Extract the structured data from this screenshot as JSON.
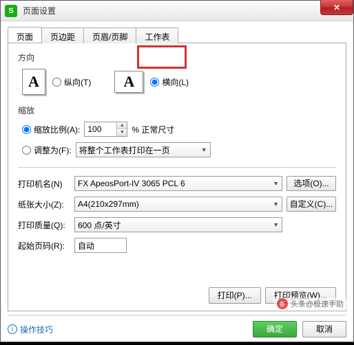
{
  "window": {
    "title": "页面设置"
  },
  "tabs": {
    "t0": "页面",
    "t1": "页边距",
    "t2": "页眉/页脚",
    "t3": "工作表"
  },
  "orient": {
    "label": "方向",
    "portrait": "纵向(T)",
    "landscape": "横向(L)",
    "iconA": "A"
  },
  "scale": {
    "label": "缩放",
    "ratio": "缩放比例(A):",
    "ratioVal": "100",
    "ratioSuffix": "% 正常尺寸",
    "fit": "调整为(F):",
    "fitVal": "将整个工作表打印在一页"
  },
  "printer": {
    "nameLbl": "打印机名(N)",
    "nameVal": "FX ApeosPort-IV 3065 PCL 6",
    "options": "选项(O)...",
    "sizeLbl": "纸张大小(Z):",
    "sizeVal": "A4(210x297mm)",
    "custom": "自定义(C)...",
    "qualLbl": "打印质量(Q):",
    "qualVal": "600 点/英寸",
    "startLbl": "起始页码(R):",
    "startVal": "自动"
  },
  "actions": {
    "print": "打印(P)...",
    "preview": "打印预览(W)..."
  },
  "footer": {
    "tips": "操作技巧",
    "ok": "确定",
    "cancel": "取消"
  },
  "watermark": {
    "text": "头条@极速手助"
  }
}
